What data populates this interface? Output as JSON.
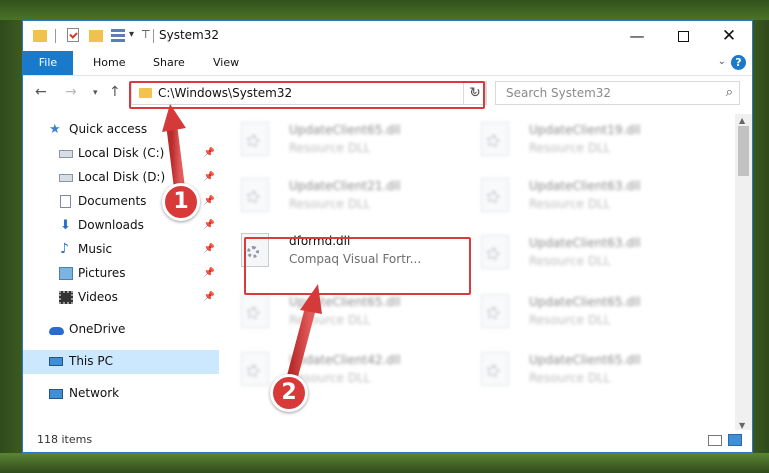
{
  "window": {
    "title": "System32",
    "controls": {
      "minimize": "—",
      "maximize": "",
      "close": "✕"
    }
  },
  "ribbon": {
    "tabs": [
      "File",
      "Home",
      "Share",
      "View"
    ],
    "help": "?"
  },
  "address": {
    "path": "C:\\Windows\\System32",
    "search_placeholder": "Search System32"
  },
  "sidebar": {
    "quick_access": "Quick access",
    "items": [
      {
        "label": "Local Disk (C:)"
      },
      {
        "label": "Local Disk (D:)"
      },
      {
        "label": "Documents"
      },
      {
        "label": "Downloads"
      },
      {
        "label": "Music"
      },
      {
        "label": "Pictures"
      },
      {
        "label": "Videos"
      }
    ],
    "onedrive": "OneDrive",
    "this_pc": "This PC",
    "network": "Network"
  },
  "files": {
    "left": [
      {
        "name": "UpdateClient65.dll",
        "desc": "Resource DLL"
      },
      {
        "name": "UpdateClient21.dll",
        "desc": "Resource DLL"
      },
      {
        "name": "dformd.dll",
        "desc": "Compaq Visual Fortr..."
      },
      {
        "name": "UpdateClient65.dll",
        "desc": "Resource DLL"
      },
      {
        "name": "UpdateClient42.dll",
        "desc": "Resource DLL"
      }
    ],
    "right": [
      {
        "name": "UpdateClient19.dll",
        "desc": "Resource DLL"
      },
      {
        "name": "UpdateClient63.dll",
        "desc": "Resource DLL"
      },
      {
        "name": "UpdateClient63.dll",
        "desc": "Resource DLL"
      },
      {
        "name": "UpdateClient65.dll",
        "desc": "Resource DLL"
      },
      {
        "name": "UpdateClient65.dll",
        "desc": "Resource DLL"
      }
    ]
  },
  "status": {
    "item_count": "118 items"
  },
  "callouts": {
    "step1": "1",
    "step2": "2"
  },
  "colors": {
    "accent": "#1979ca",
    "callout": "#d83a3a",
    "selection": "#cce8ff"
  }
}
